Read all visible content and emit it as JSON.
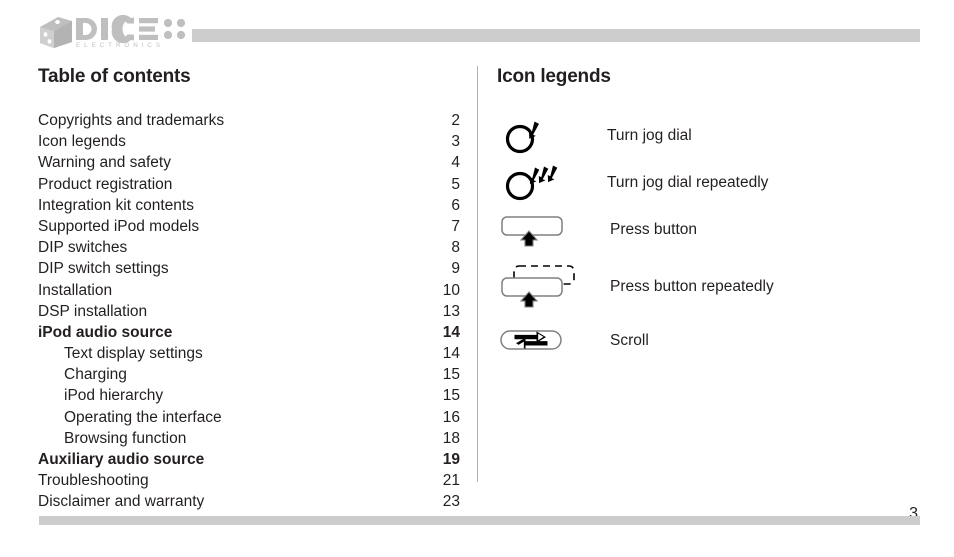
{
  "document": {
    "page_number": "3",
    "brand": {
      "name": "DICE",
      "tagline": "ELECTRONICS"
    },
    "colors": {
      "text": "#231f20",
      "bar_gray": "#cccccc",
      "logo_gray": "#bfbfbf",
      "divider": "#b3b3b3",
      "icon_outline": "#808080",
      "icon_black": "#000000"
    }
  },
  "toc": {
    "title": "Table of contents",
    "entries": [
      {
        "label": "Copyrights and trademarks",
        "page": "2",
        "bold": false,
        "indent": false
      },
      {
        "label": "Icon legends",
        "page": "3",
        "bold": false,
        "indent": false
      },
      {
        "label": "Warning and safety",
        "page": "4",
        "bold": false,
        "indent": false
      },
      {
        "label": "Product registration",
        "page": "5",
        "bold": false,
        "indent": false
      },
      {
        "label": "Integration kit contents",
        "page": "6",
        "bold": false,
        "indent": false
      },
      {
        "label": "Supported iPod models",
        "page": "7",
        "bold": false,
        "indent": false
      },
      {
        "label": "DIP switches",
        "page": "8",
        "bold": false,
        "indent": false
      },
      {
        "label": "DIP switch settings",
        "page": "9",
        "bold": false,
        "indent": false
      },
      {
        "label": "Installation",
        "page": "10",
        "bold": false,
        "indent": false
      },
      {
        "label": "DSP installation",
        "page": "13",
        "bold": false,
        "indent": false
      },
      {
        "label": "iPod audio source",
        "page": "14",
        "bold": true,
        "indent": false
      },
      {
        "label": "Text display settings",
        "page": "14",
        "bold": false,
        "indent": true
      },
      {
        "label": "Charging",
        "page": "15",
        "bold": false,
        "indent": true
      },
      {
        "label": "iPod hierarchy",
        "page": "15",
        "bold": false,
        "indent": true
      },
      {
        "label": "Operating the interface",
        "page": "16",
        "bold": false,
        "indent": true
      },
      {
        "label": "Browsing function",
        "page": "18",
        "bold": false,
        "indent": true
      },
      {
        "label": "Auxiliary audio source",
        "page": "19",
        "bold": true,
        "indent": false
      },
      {
        "label": "Troubleshooting",
        "page": "21",
        "bold": false,
        "indent": false
      },
      {
        "label": "Disclaimer and warranty",
        "page": "23",
        "bold": false,
        "indent": false
      }
    ]
  },
  "legends": {
    "title": "Icon legends",
    "items": [
      {
        "icon": "jog-dial-turn-icon",
        "label": "Turn jog dial"
      },
      {
        "icon": "jog-dial-turn-repeatedly-icon",
        "label": "Turn jog dial repeatedly"
      },
      {
        "icon": "press-button-icon",
        "label": "Press button"
      },
      {
        "icon": "press-button-repeatedly-icon",
        "label": "Press button repeatedly"
      },
      {
        "icon": "scroll-icon",
        "label": "Scroll"
      }
    ]
  }
}
